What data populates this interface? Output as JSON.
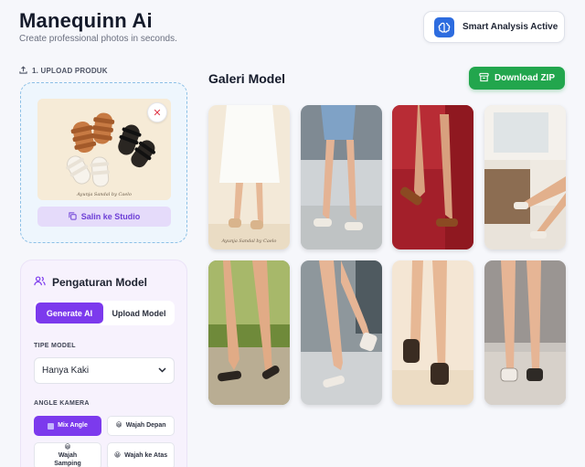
{
  "header": {
    "title": "Manequinn Ai",
    "subtitle": "Create professional photos in seconds."
  },
  "status": {
    "label": "Smart Analysis Active",
    "icon": "brain-icon",
    "color": "#2d6cdf"
  },
  "upload": {
    "label": "1. UPLOAD PRODUK",
    "preview_caption": "Ayunja Sandal by Caelo",
    "copy_label": "Salin ke Studio",
    "remove_icon": "close-icon"
  },
  "settings": {
    "title": "Pengaturan Model",
    "tabs": [
      {
        "label": "Generate AI",
        "active": true
      },
      {
        "label": "Upload Model",
        "active": false
      }
    ],
    "model_type_label": "TIPE MODEL",
    "model_type_value": "Hanya Kaki",
    "camera_label": "ANGLE KAMERA",
    "angles": [
      {
        "label": "Mix Angle",
        "active": true
      },
      {
        "label": "Wajah Depan",
        "active": false
      },
      {
        "label": "Wajah Samping",
        "active": false
      },
      {
        "label": "Wajah ke Atas",
        "active": false
      }
    ]
  },
  "gallery": {
    "title": "Galeri Model",
    "download_label": "Download ZIP",
    "download_color": "#22a64d",
    "images": [
      {
        "name": "model-photo-1",
        "caption": "Ayunja Sandal by Caelo"
      },
      {
        "name": "model-photo-2"
      },
      {
        "name": "model-photo-3"
      },
      {
        "name": "model-photo-4"
      },
      {
        "name": "model-photo-5"
      },
      {
        "name": "model-photo-6"
      },
      {
        "name": "model-photo-7"
      },
      {
        "name": "model-photo-8"
      }
    ]
  },
  "colors": {
    "accent": "#7c3aed",
    "upload_border": "#8cc0e6",
    "remove": "#e03a4a"
  }
}
